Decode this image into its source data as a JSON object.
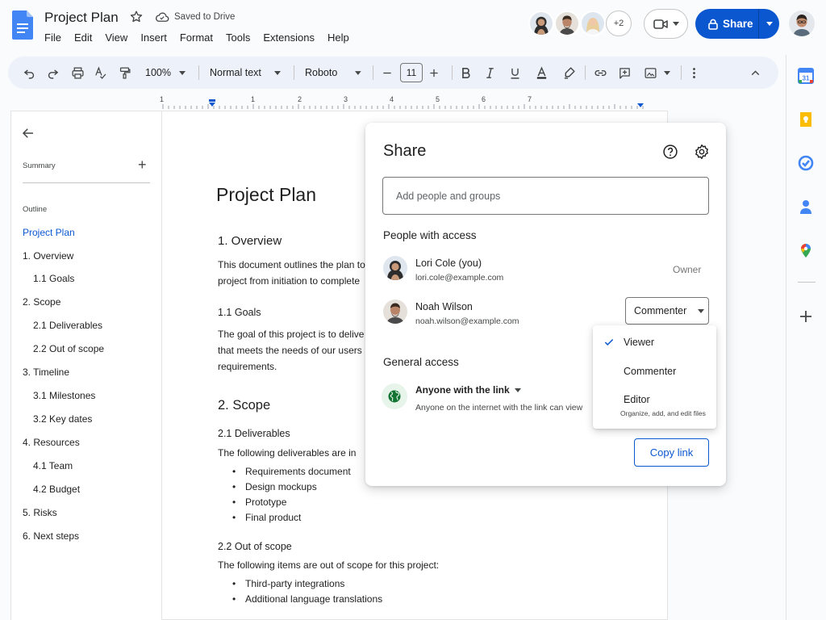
{
  "header": {
    "title": "Project Plan",
    "saved_status": "Saved to Drive",
    "menu": [
      "File",
      "Edit",
      "View",
      "Insert",
      "Format",
      "Tools",
      "Extensions",
      "Help"
    ],
    "collaborators_more": "+2",
    "share_label": "Share",
    "accent_color": "#0b57d0"
  },
  "toolbar": {
    "zoom": "100%",
    "style": "Normal text",
    "font": "Roboto",
    "font_size": "11"
  },
  "ruler": {
    "numbers": [
      "1",
      "1",
      "2",
      "3",
      "4",
      "5",
      "6",
      "7"
    ]
  },
  "sidebar": {
    "summary_label": "Summary",
    "outline_label": "Outline",
    "items": [
      {
        "label": "Project Plan"
      },
      {
        "label": "1. Overview"
      },
      {
        "label": "1.1 Goals"
      },
      {
        "label": "2. Scope"
      },
      {
        "label": "2.1 Deliverables"
      },
      {
        "label": "2.2 Out of scope"
      },
      {
        "label": "3. Timeline"
      },
      {
        "label": "3.1 Milestones"
      },
      {
        "label": "3.2 Key dates"
      },
      {
        "label": "4. Resources"
      },
      {
        "label": "4.1 Team"
      },
      {
        "label": "4.2 Budget"
      },
      {
        "label": "5. Risks"
      },
      {
        "label": "6. Next steps"
      }
    ]
  },
  "document": {
    "title": "Project Plan",
    "overview_heading": "1. Overview",
    "overview_line1": "This document outlines the plan to",
    "overview_line2": "project from initiation to complete",
    "goals_heading": "1.1 Goals",
    "goals_line1": "The goal of this project is to delive",
    "goals_line2": "that meets the needs of our users",
    "goals_line3": "requirements.",
    "scope_heading": "2. Scope",
    "deliverables_heading": "2.1 Deliverables",
    "deliverables_intro": "The following deliverables are in",
    "deliverables": [
      "Requirements document",
      "Design mockups",
      "Prototype",
      "Final product"
    ],
    "out_of_scope_heading": "2.2 Out of scope",
    "out_of_scope_intro": "The following items are out of scope for this project:",
    "out_of_scope": [
      "Third-party integrations",
      "Additional language translations"
    ]
  },
  "share_dialog": {
    "title": "Share",
    "add_placeholder": "Add people and groups",
    "people_label": "People with access",
    "people": [
      {
        "name": "Lori Cole (you)",
        "email": "lori.cole@example.com",
        "role": "Owner"
      },
      {
        "name": "Noah Wilson",
        "email": "noah.wilson@example.com",
        "role": "Commenter"
      }
    ],
    "general_access_label": "General access",
    "general_access_value": "Anyone with the link",
    "general_access_desc": "Anyone on the internet with the link can view",
    "copy_link": "Copy link"
  },
  "role_menu": {
    "selected": "Viewer",
    "items": [
      "Viewer",
      "Commenter",
      "Editor"
    ],
    "editor_desc": "Organize, add, and edit files"
  }
}
